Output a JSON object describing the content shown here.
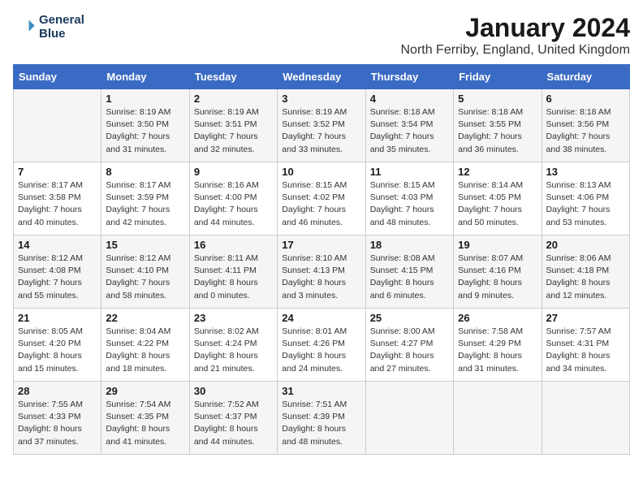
{
  "logo": {
    "line1": "General",
    "line2": "Blue"
  },
  "title": "January 2024",
  "location": "North Ferriby, England, United Kingdom",
  "days_of_week": [
    "Sunday",
    "Monday",
    "Tuesday",
    "Wednesday",
    "Thursday",
    "Friday",
    "Saturday"
  ],
  "weeks": [
    [
      {
        "day": "",
        "info": ""
      },
      {
        "day": "1",
        "info": "Sunrise: 8:19 AM\nSunset: 3:50 PM\nDaylight: 7 hours\nand 31 minutes."
      },
      {
        "day": "2",
        "info": "Sunrise: 8:19 AM\nSunset: 3:51 PM\nDaylight: 7 hours\nand 32 minutes."
      },
      {
        "day": "3",
        "info": "Sunrise: 8:19 AM\nSunset: 3:52 PM\nDaylight: 7 hours\nand 33 minutes."
      },
      {
        "day": "4",
        "info": "Sunrise: 8:18 AM\nSunset: 3:54 PM\nDaylight: 7 hours\nand 35 minutes."
      },
      {
        "day": "5",
        "info": "Sunrise: 8:18 AM\nSunset: 3:55 PM\nDaylight: 7 hours\nand 36 minutes."
      },
      {
        "day": "6",
        "info": "Sunrise: 8:18 AM\nSunset: 3:56 PM\nDaylight: 7 hours\nand 38 minutes."
      }
    ],
    [
      {
        "day": "7",
        "info": "Sunrise: 8:17 AM\nSunset: 3:58 PM\nDaylight: 7 hours\nand 40 minutes."
      },
      {
        "day": "8",
        "info": "Sunrise: 8:17 AM\nSunset: 3:59 PM\nDaylight: 7 hours\nand 42 minutes."
      },
      {
        "day": "9",
        "info": "Sunrise: 8:16 AM\nSunset: 4:00 PM\nDaylight: 7 hours\nand 44 minutes."
      },
      {
        "day": "10",
        "info": "Sunrise: 8:15 AM\nSunset: 4:02 PM\nDaylight: 7 hours\nand 46 minutes."
      },
      {
        "day": "11",
        "info": "Sunrise: 8:15 AM\nSunset: 4:03 PM\nDaylight: 7 hours\nand 48 minutes."
      },
      {
        "day": "12",
        "info": "Sunrise: 8:14 AM\nSunset: 4:05 PM\nDaylight: 7 hours\nand 50 minutes."
      },
      {
        "day": "13",
        "info": "Sunrise: 8:13 AM\nSunset: 4:06 PM\nDaylight: 7 hours\nand 53 minutes."
      }
    ],
    [
      {
        "day": "14",
        "info": "Sunrise: 8:12 AM\nSunset: 4:08 PM\nDaylight: 7 hours\nand 55 minutes."
      },
      {
        "day": "15",
        "info": "Sunrise: 8:12 AM\nSunset: 4:10 PM\nDaylight: 7 hours\nand 58 minutes."
      },
      {
        "day": "16",
        "info": "Sunrise: 8:11 AM\nSunset: 4:11 PM\nDaylight: 8 hours\nand 0 minutes."
      },
      {
        "day": "17",
        "info": "Sunrise: 8:10 AM\nSunset: 4:13 PM\nDaylight: 8 hours\nand 3 minutes."
      },
      {
        "day": "18",
        "info": "Sunrise: 8:08 AM\nSunset: 4:15 PM\nDaylight: 8 hours\nand 6 minutes."
      },
      {
        "day": "19",
        "info": "Sunrise: 8:07 AM\nSunset: 4:16 PM\nDaylight: 8 hours\nand 9 minutes."
      },
      {
        "day": "20",
        "info": "Sunrise: 8:06 AM\nSunset: 4:18 PM\nDaylight: 8 hours\nand 12 minutes."
      }
    ],
    [
      {
        "day": "21",
        "info": "Sunrise: 8:05 AM\nSunset: 4:20 PM\nDaylight: 8 hours\nand 15 minutes."
      },
      {
        "day": "22",
        "info": "Sunrise: 8:04 AM\nSunset: 4:22 PM\nDaylight: 8 hours\nand 18 minutes."
      },
      {
        "day": "23",
        "info": "Sunrise: 8:02 AM\nSunset: 4:24 PM\nDaylight: 8 hours\nand 21 minutes."
      },
      {
        "day": "24",
        "info": "Sunrise: 8:01 AM\nSunset: 4:26 PM\nDaylight: 8 hours\nand 24 minutes."
      },
      {
        "day": "25",
        "info": "Sunrise: 8:00 AM\nSunset: 4:27 PM\nDaylight: 8 hours\nand 27 minutes."
      },
      {
        "day": "26",
        "info": "Sunrise: 7:58 AM\nSunset: 4:29 PM\nDaylight: 8 hours\nand 31 minutes."
      },
      {
        "day": "27",
        "info": "Sunrise: 7:57 AM\nSunset: 4:31 PM\nDaylight: 8 hours\nand 34 minutes."
      }
    ],
    [
      {
        "day": "28",
        "info": "Sunrise: 7:55 AM\nSunset: 4:33 PM\nDaylight: 8 hours\nand 37 minutes."
      },
      {
        "day": "29",
        "info": "Sunrise: 7:54 AM\nSunset: 4:35 PM\nDaylight: 8 hours\nand 41 minutes."
      },
      {
        "day": "30",
        "info": "Sunrise: 7:52 AM\nSunset: 4:37 PM\nDaylight: 8 hours\nand 44 minutes."
      },
      {
        "day": "31",
        "info": "Sunrise: 7:51 AM\nSunset: 4:39 PM\nDaylight: 8 hours\nand 48 minutes."
      },
      {
        "day": "",
        "info": ""
      },
      {
        "day": "",
        "info": ""
      },
      {
        "day": "",
        "info": ""
      }
    ]
  ]
}
